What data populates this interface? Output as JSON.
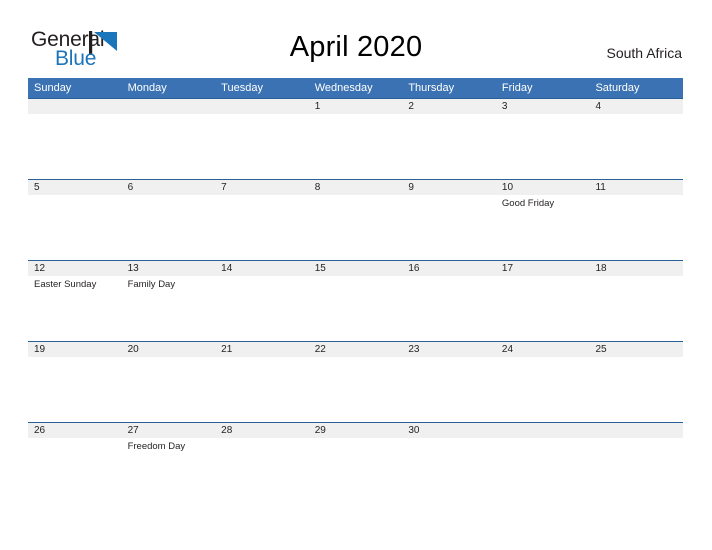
{
  "brand": {
    "name_part1": "General",
    "name_part2": "Blue",
    "mark": "triangle-flag-mark",
    "color_dark": "#231f20",
    "color_blue": "#1b75bb"
  },
  "header": {
    "title": "April 2020",
    "region": "South Africa"
  },
  "theme": {
    "header_blue": "#3a72b3",
    "row_border_blue": "#2a6099",
    "number_band_gray": "#f0f0f0",
    "text_dark": "#231f20",
    "page_background": "#ffffff"
  },
  "calendar": {
    "weekdays": [
      "Sunday",
      "Monday",
      "Tuesday",
      "Wednesday",
      "Thursday",
      "Friday",
      "Saturday"
    ],
    "weeks": [
      {
        "days": [
          {
            "number": "",
            "event": ""
          },
          {
            "number": "",
            "event": ""
          },
          {
            "number": "",
            "event": ""
          },
          {
            "number": "1",
            "event": ""
          },
          {
            "number": "2",
            "event": ""
          },
          {
            "number": "3",
            "event": ""
          },
          {
            "number": "4",
            "event": ""
          }
        ]
      },
      {
        "days": [
          {
            "number": "5",
            "event": ""
          },
          {
            "number": "6",
            "event": ""
          },
          {
            "number": "7",
            "event": ""
          },
          {
            "number": "8",
            "event": ""
          },
          {
            "number": "9",
            "event": ""
          },
          {
            "number": "10",
            "event": "Good Friday"
          },
          {
            "number": "11",
            "event": ""
          }
        ]
      },
      {
        "days": [
          {
            "number": "12",
            "event": "Easter Sunday"
          },
          {
            "number": "13",
            "event": "Family Day"
          },
          {
            "number": "14",
            "event": ""
          },
          {
            "number": "15",
            "event": ""
          },
          {
            "number": "16",
            "event": ""
          },
          {
            "number": "17",
            "event": ""
          },
          {
            "number": "18",
            "event": ""
          }
        ]
      },
      {
        "days": [
          {
            "number": "19",
            "event": ""
          },
          {
            "number": "20",
            "event": ""
          },
          {
            "number": "21",
            "event": ""
          },
          {
            "number": "22",
            "event": ""
          },
          {
            "number": "23",
            "event": ""
          },
          {
            "number": "24",
            "event": ""
          },
          {
            "number": "25",
            "event": ""
          }
        ]
      },
      {
        "days": [
          {
            "number": "26",
            "event": ""
          },
          {
            "number": "27",
            "event": "Freedom Day"
          },
          {
            "number": "28",
            "event": ""
          },
          {
            "number": "29",
            "event": ""
          },
          {
            "number": "30",
            "event": ""
          },
          {
            "number": "",
            "event": ""
          },
          {
            "number": "",
            "event": ""
          }
        ]
      }
    ]
  }
}
